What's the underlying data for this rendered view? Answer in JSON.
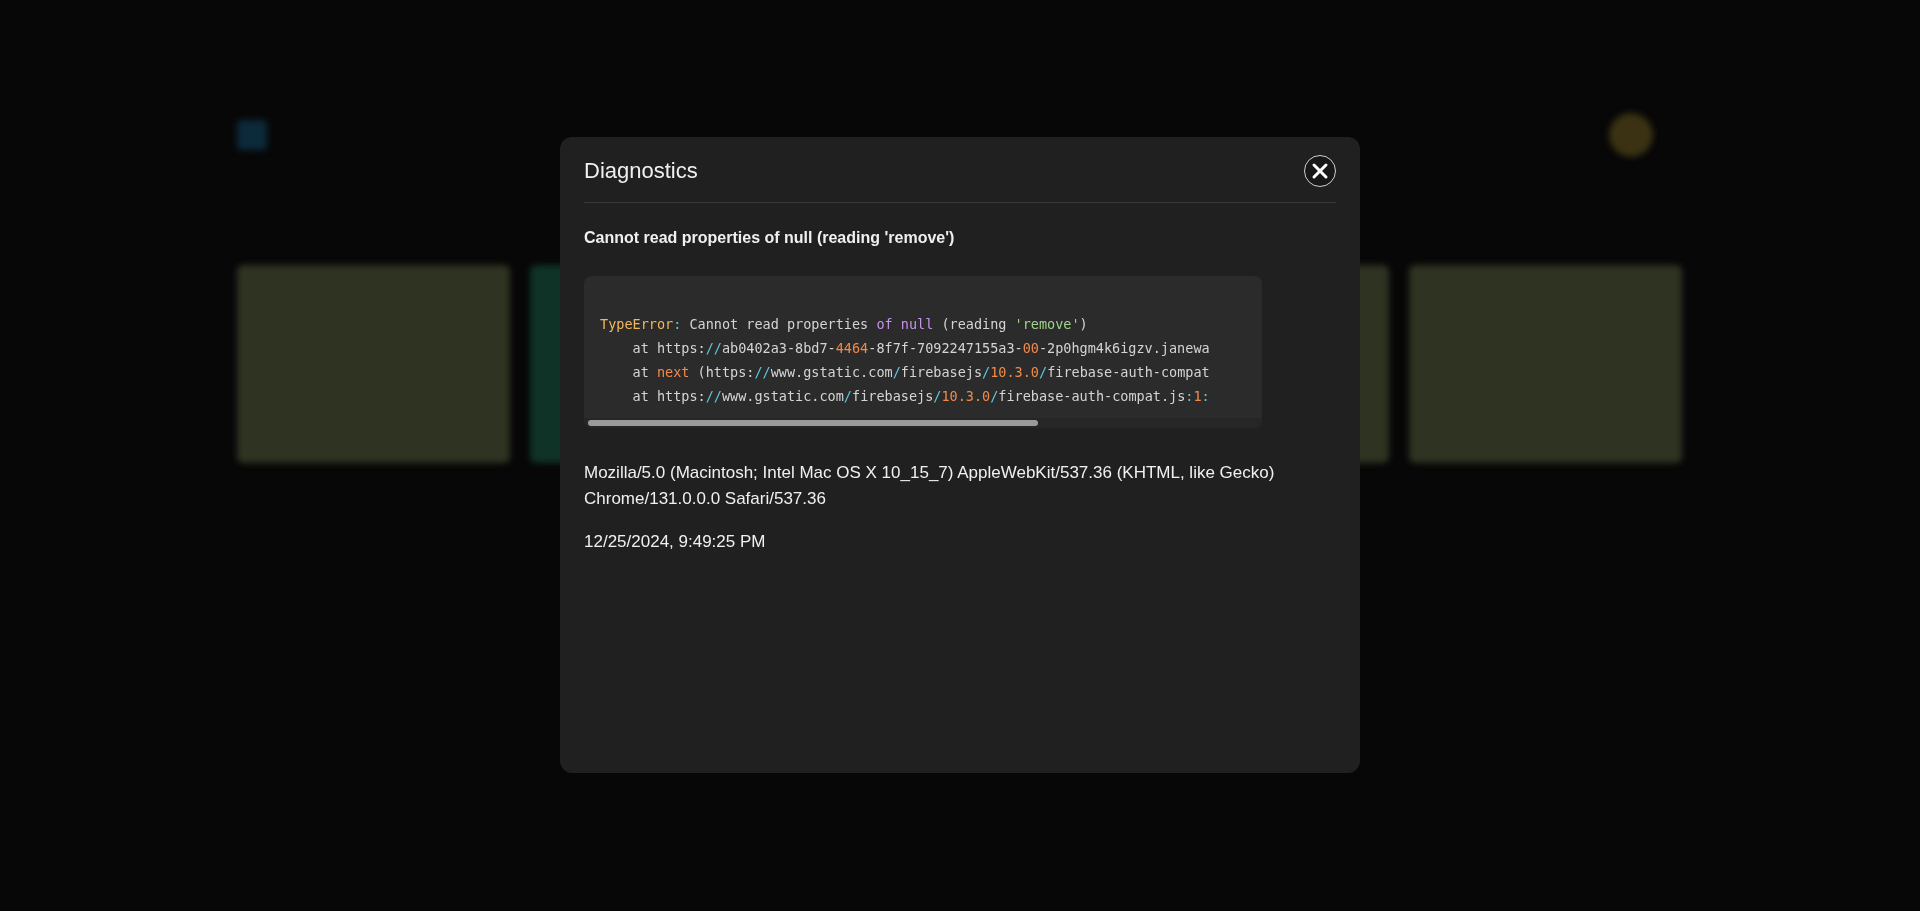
{
  "background": {
    "cards": [
      {
        "color": "#2f3322"
      },
      {
        "color": "#0f3326"
      },
      {
        "color": "#2f3322"
      },
      {
        "color": "#2f3322"
      }
    ]
  },
  "dialog": {
    "title": "Diagnostics",
    "message": "Cannot read properties of null (reading 'remove')",
    "code_lines": [
      [
        {
          "kind": "type",
          "text": "TypeError"
        },
        {
          "kind": "punct",
          "text": ":"
        },
        {
          "kind": "plain",
          "text": " Cannot read properties "
        },
        {
          "kind": "keyword",
          "text": "of null"
        },
        {
          "kind": "plain",
          "text": " (reading "
        },
        {
          "kind": "string",
          "text": "'remove'"
        },
        {
          "kind": "plain",
          "text": ")"
        }
      ],
      [
        {
          "kind": "plain",
          "text": "    at https:"
        },
        {
          "kind": "punct",
          "text": "//"
        },
        {
          "kind": "plain",
          "text": "ab0402a3-8bd7-"
        },
        {
          "kind": "number",
          "text": "4464"
        },
        {
          "kind": "plain",
          "text": "-8f7f-7092247155a3-"
        },
        {
          "kind": "number",
          "text": "00"
        },
        {
          "kind": "plain",
          "text": "-2p0hgm4k6igzv.janewa"
        }
      ],
      [
        {
          "kind": "plain",
          "text": "    at "
        },
        {
          "kind": "number",
          "text": "next"
        },
        {
          "kind": "plain",
          "text": " (https:"
        },
        {
          "kind": "punct",
          "text": "//"
        },
        {
          "kind": "plain",
          "text": "www.gstatic.com"
        },
        {
          "kind": "punct",
          "text": "/"
        },
        {
          "kind": "plain",
          "text": "firebasejs"
        },
        {
          "kind": "punct",
          "text": "/"
        },
        {
          "kind": "number",
          "text": "10.3.0"
        },
        {
          "kind": "punct",
          "text": "/"
        },
        {
          "kind": "plain",
          "text": "firebase-auth-compat"
        }
      ],
      [
        {
          "kind": "plain",
          "text": "    at https:"
        },
        {
          "kind": "punct",
          "text": "//"
        },
        {
          "kind": "plain",
          "text": "www.gstatic.com"
        },
        {
          "kind": "punct",
          "text": "/"
        },
        {
          "kind": "plain",
          "text": "firebasejs"
        },
        {
          "kind": "punct",
          "text": "/"
        },
        {
          "kind": "number",
          "text": "10.3.0"
        },
        {
          "kind": "punct",
          "text": "/"
        },
        {
          "kind": "plain",
          "text": "firebase-auth-compat.js"
        },
        {
          "kind": "punct",
          "text": ":"
        },
        {
          "kind": "number",
          "text": "1"
        },
        {
          "kind": "punct",
          "text": ":"
        }
      ]
    ],
    "user_agent": "Mozilla/5.0 (Macintosh; Intel Mac OS X 10_15_7) AppleWebKit/537.36 (KHTML, like Gecko) Chrome/131.0.0.0 Safari/537.36",
    "timestamp": "12/25/2024, 9:49:25 PM"
  }
}
